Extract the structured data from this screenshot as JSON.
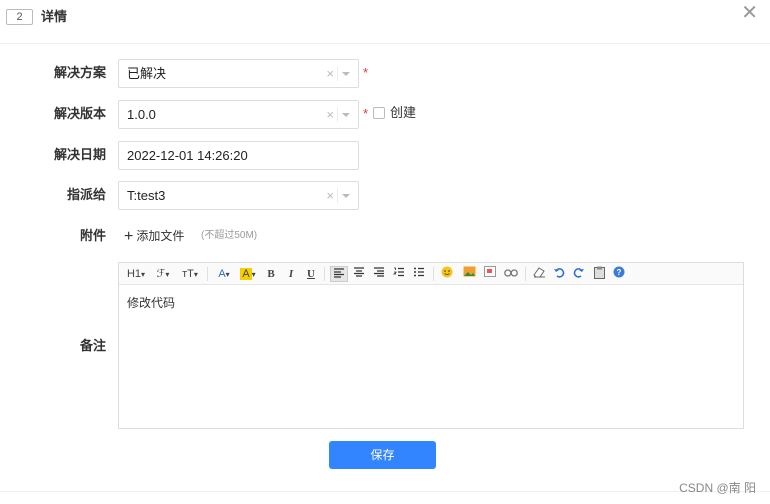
{
  "header": {
    "id": "2",
    "title": "详情",
    "close": "✕"
  },
  "form": {
    "solution": {
      "label": "解决方案",
      "value": "已解决",
      "clear": "×",
      "required": "*"
    },
    "version": {
      "label": "解决版本",
      "value": "1.0.0",
      "clear": "×",
      "required": "*",
      "create_label": "创建"
    },
    "date": {
      "label": "解决日期",
      "value": "2022-12-01 14:26:20"
    },
    "assign": {
      "label": "指派给",
      "value": "T:test3",
      "clear": "×"
    },
    "attachment": {
      "label": "附件",
      "add_label": "添加文件",
      "plus": "+",
      "hint": "(不超过50M)"
    },
    "remark": {
      "label": "备注",
      "content": "修改代码",
      "toolbar": {
        "heading": "H1",
        "font": "ℱ",
        "size": "тT",
        "font_color": "A",
        "bg_color": "A",
        "bold": "B",
        "italic": "I",
        "underline": "U"
      }
    }
  },
  "save_label": "保存",
  "watermark": "CSDN @南 阳",
  "colors": {
    "primary": "#3385ff",
    "required": "#ee3333"
  }
}
